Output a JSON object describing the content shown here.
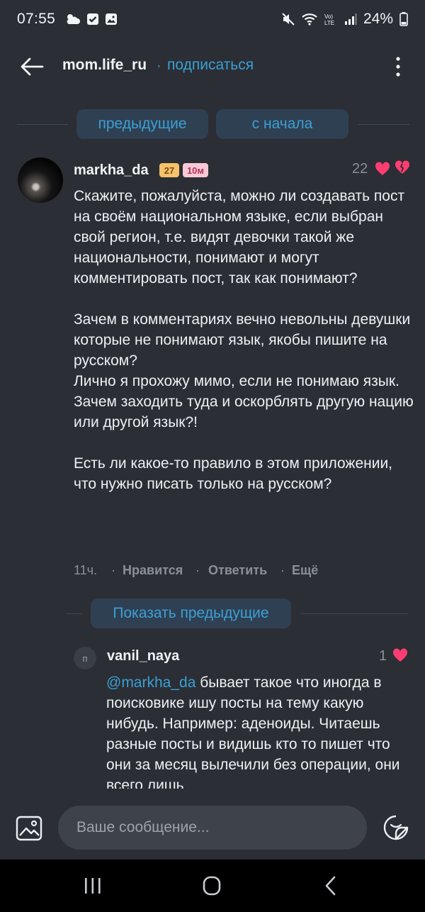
{
  "status_bar": {
    "time": "07:55",
    "battery": "24%",
    "left_icons": [
      "cloud-sun-icon",
      "check-box-icon",
      "gallery-icon"
    ],
    "right_icons": [
      "mute-icon",
      "wifi-icon",
      "volte-icon",
      "signal-icon",
      "battery-icon"
    ]
  },
  "header": {
    "title": "mom.life_ru",
    "separator": "·",
    "subscribe": "подписаться"
  },
  "pager": {
    "previous": "предыдущие",
    "from_start": "с начала"
  },
  "comment": {
    "author": "markha_da",
    "badge_age": "27",
    "badge_kid": "10м",
    "likes": "22",
    "text": "Скажите, пожалуйста,  можно ли создавать пост на своём национальном языке, если выбран свой регион, т.е. видят девочки такой же национальности, понимают и могут комментировать пост, так как понимают?\n\nЗачем в комментариях вечно невольны девушки которые не понимают язык, якобы пишите на русском?\nЛично я прохожу мимо, если не понимаю язык.\nЗачем заходить туда и оскорблять другую нацию или другой язык?!\n\nЕсть ли какое-то правило в этом приложении, что нужно писать только на русском?",
    "time": "11ч.",
    "like_action": "Нравится",
    "reply_action": "Ответить",
    "more_action": "Ещё",
    "dot": "·"
  },
  "show_previous": "Показать предыдущие",
  "reply": {
    "avatar_letter": "п",
    "author": "vanil_naya",
    "likes": "1",
    "mention": "@markha_da",
    "text": " бывает такое что иногда в поисковике ишу посты на тему какую нибудь. Например: аденоиды. Читаешь разные посты и видишь кто то пишет что они за месяц вылечили без операции, они всего лишь"
  },
  "input": {
    "placeholder": "Ваше сообщение..."
  },
  "colors": {
    "background": "#2b2e34",
    "accent": "#3aa0d6",
    "pill": "#2f4052",
    "heart": "#ff3d73"
  }
}
